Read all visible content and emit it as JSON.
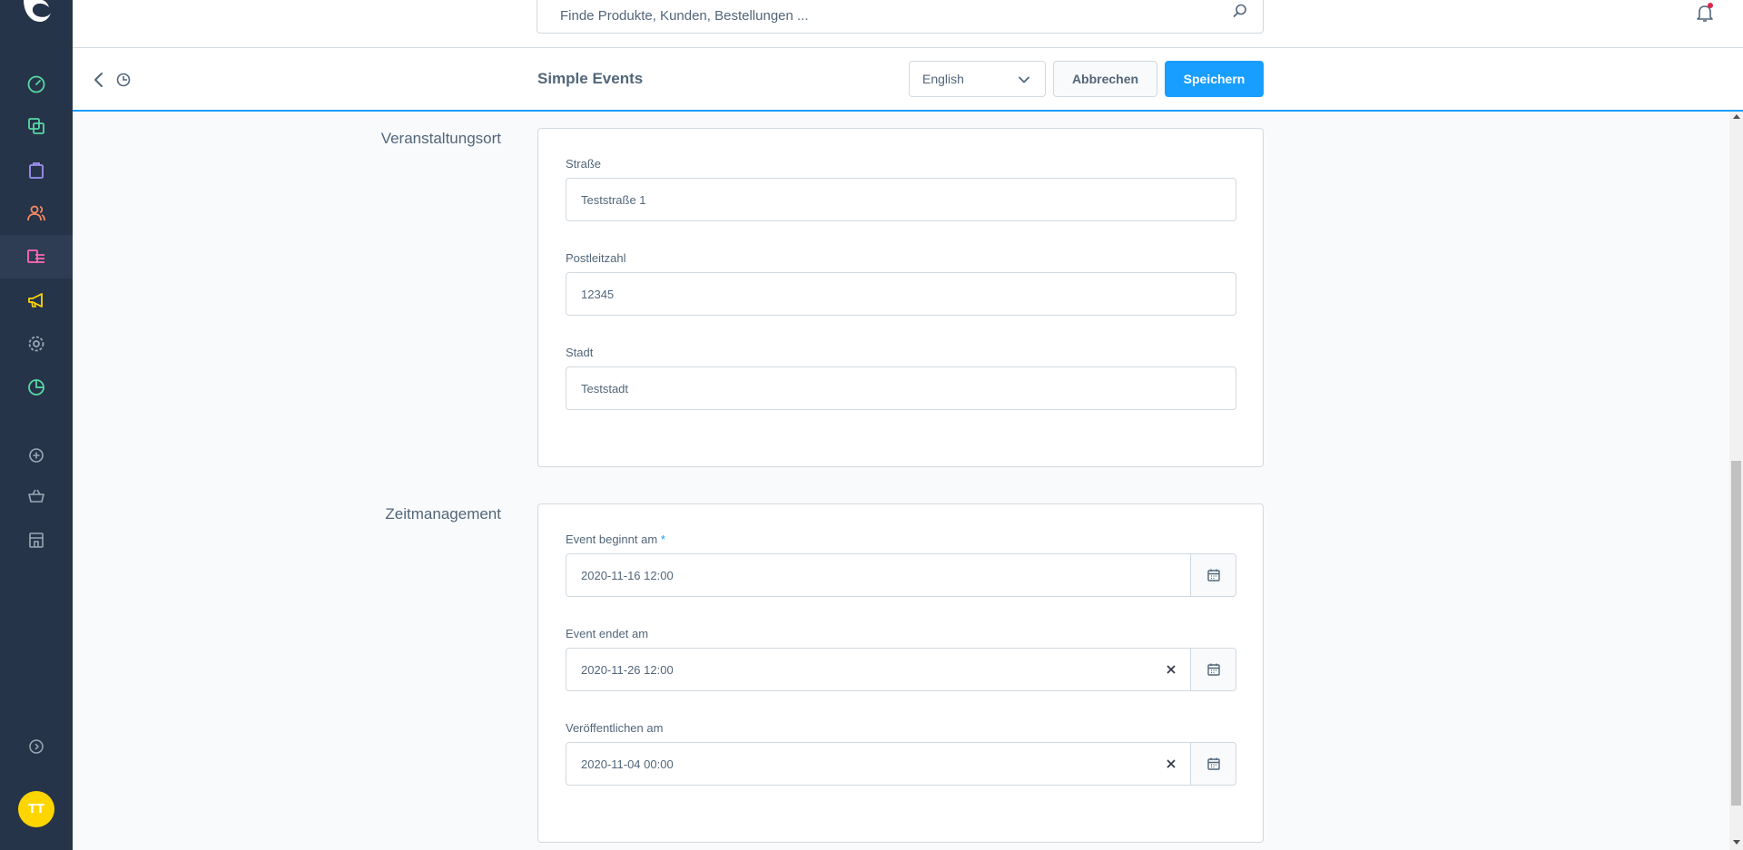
{
  "colors": {
    "sidebar_bg": "#26344a",
    "accent": "#189eff",
    "text": "#52667a",
    "avatar_bg": "#ffd500"
  },
  "sidebar": {
    "items": [
      {
        "name": "dashboard",
        "icon": "gauge-icon",
        "color": "#57d9a3"
      },
      {
        "name": "catalogues",
        "icon": "stack-icon",
        "color": "#57d9a3"
      },
      {
        "name": "orders",
        "icon": "shopping-bag-icon",
        "color": "#a092f0"
      },
      {
        "name": "customers",
        "icon": "users-icon",
        "color": "#f88962"
      },
      {
        "name": "content",
        "icon": "content-list-icon",
        "color": "#ff68b4"
      },
      {
        "name": "marketing",
        "icon": "megaphone-icon",
        "color": "#ffd700"
      },
      {
        "name": "settings",
        "icon": "gear-icon",
        "color": "#9aa8b5"
      },
      {
        "name": "analytics",
        "icon": "pie-chart-icon",
        "color": "#57d9a3"
      },
      {
        "name": "extensions",
        "icon": "plus-circle-icon",
        "color": "#9aa8b5"
      },
      {
        "name": "sales-channel",
        "icon": "basket-icon",
        "color": "#9aa8b5"
      },
      {
        "name": "storefront",
        "icon": "store-icon",
        "color": "#9aa8b5"
      },
      {
        "name": "collapse",
        "icon": "chevron-circle-icon",
        "color": "#9aa8b5"
      }
    ],
    "avatar_initials": "TT"
  },
  "search": {
    "placeholder": "Finde Produkte, Kunden, Bestellungen ..."
  },
  "smartbar": {
    "title": "Simple Events",
    "language": "English",
    "cancel_label": "Abbrechen",
    "save_label": "Speichern"
  },
  "sections": {
    "location": {
      "label": "Veranstaltungsort",
      "street_label": "Straße",
      "street_value": "Teststraße 1",
      "zip_label": "Postleitzahl",
      "zip_value": "12345",
      "city_label": "Stadt",
      "city_value": "Teststadt"
    },
    "time": {
      "label": "Zeitmanagement",
      "start_label": "Event beginnt am",
      "required_mark": "*",
      "start_value": "2020-11-16 12:00",
      "end_label": "Event endet am",
      "end_value": "2020-11-26 12:00",
      "publish_label": "Veröffentlichen am",
      "publish_value": "2020-11-04 00:00"
    }
  }
}
